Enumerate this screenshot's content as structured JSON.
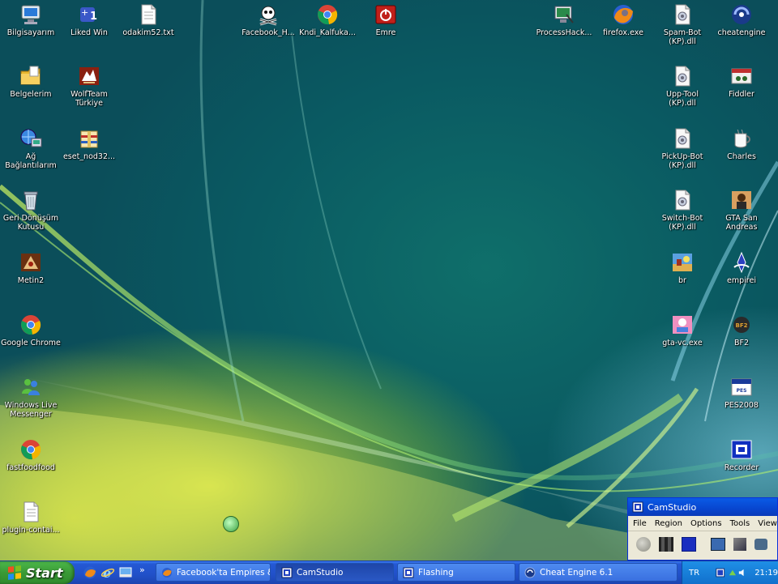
{
  "desktop": {
    "icons": [
      {
        "id": "bilgisayarim",
        "label": "Bilgisayarım",
        "icon": "computer-icon"
      },
      {
        "id": "liked-win",
        "label": "Liked Win",
        "icon": "app-plus-icon"
      },
      {
        "id": "odakim",
        "label": "odakim52.txt",
        "icon": "text-file-icon"
      },
      {
        "id": "facebook-hack",
        "label": "Facebook_H...",
        "icon": "skull-icon"
      },
      {
        "id": "kndi",
        "label": "Kndi_Kalfuka...",
        "icon": "chrome-icon"
      },
      {
        "id": "emre",
        "label": "Emre",
        "icon": "power-icon"
      },
      {
        "id": "processhacker",
        "label": "ProcessHack...",
        "icon": "monitor-icon"
      },
      {
        "id": "firefox",
        "label": "firefox.exe",
        "icon": "firefox-icon"
      },
      {
        "id": "spam-bot",
        "label": "Spam-Bot (KP).dll",
        "icon": "dll-file-icon"
      },
      {
        "id": "cheatengine",
        "label": "cheatengine",
        "icon": "cheatengine-icon"
      },
      {
        "id": "belgelerim",
        "label": "Belgelerim",
        "icon": "folder-icon"
      },
      {
        "id": "wolfteam",
        "label": "WolfTeam Türkiye",
        "icon": "wolfteam-icon"
      },
      {
        "id": "upp-tool",
        "label": "Upp-Tool (KP).dll",
        "icon": "dll-file-icon"
      },
      {
        "id": "fiddler",
        "label": "Fiddler",
        "icon": "fiddler-icon"
      },
      {
        "id": "ag",
        "label": "Ağ Bağlantılarım",
        "icon": "network-icon"
      },
      {
        "id": "eset",
        "label": "eset_nod32...",
        "icon": "archive-icon"
      },
      {
        "id": "pickup-bot",
        "label": "PickUp-Bot (KP).dll",
        "icon": "dll-file-icon"
      },
      {
        "id": "charles",
        "label": "Charles",
        "icon": "charles-icon"
      },
      {
        "id": "geri",
        "label": "Geri Dönüşüm Kutusu",
        "icon": "recycle-bin-icon"
      },
      {
        "id": "switch-bot",
        "label": "Switch-Bot (KP).dll",
        "icon": "dll-file-icon"
      },
      {
        "id": "gta-sa",
        "label": "GTA San Andreas",
        "icon": "gta-icon"
      },
      {
        "id": "metin2",
        "label": "Metin2",
        "icon": "metin2-icon"
      },
      {
        "id": "br",
        "label": "br",
        "icon": "game-icon"
      },
      {
        "id": "empirei",
        "label": "empirei",
        "icon": "empire-icon"
      },
      {
        "id": "chrome",
        "label": "Google Chrome",
        "icon": "chrome-icon"
      },
      {
        "id": "gta-vc",
        "label": "gta-vc.exe",
        "icon": "gta-vc-icon"
      },
      {
        "id": "bf2",
        "label": "BF2",
        "icon": "bf2-icon"
      },
      {
        "id": "wlm",
        "label": "Windows Live Messenger",
        "icon": "messenger-icon"
      },
      {
        "id": "pes",
        "label": "PES2008",
        "icon": "pes-icon"
      },
      {
        "id": "fast-food",
        "label": "fastfoodfood",
        "icon": "chrome-icon"
      },
      {
        "id": "recorder",
        "label": "Recorder",
        "icon": "recorder-icon"
      },
      {
        "id": "plugin",
        "label": "plugin-contai...",
        "icon": "text-file-icon"
      }
    ]
  },
  "taskbar": {
    "start_label": "Start",
    "quick_launch": [
      "firefox-icon",
      "ie-icon",
      "desktop-icon"
    ],
    "overflow": "»",
    "tasks": [
      {
        "label": "Facebook'ta Empires &...",
        "icon": "firefox-icon",
        "active": false
      },
      {
        "label": "CamStudio",
        "icon": "camstudio-icon",
        "active": true
      },
      {
        "label": "Flashing",
        "icon": "camstudio-icon",
        "active": false
      },
      {
        "label": "Cheat Engine 6.1",
        "icon": "cheatengine-icon",
        "active": false
      }
    ],
    "tray": {
      "lang": "TR",
      "time": "21:19"
    }
  },
  "camstudio": {
    "title": "CamStudio",
    "menu": [
      "File",
      "Region",
      "Options",
      "Tools",
      "View"
    ]
  },
  "colors": {
    "taskbar": "#2150c8",
    "start": "#3a9a36",
    "camtitle": "#0846cf"
  }
}
